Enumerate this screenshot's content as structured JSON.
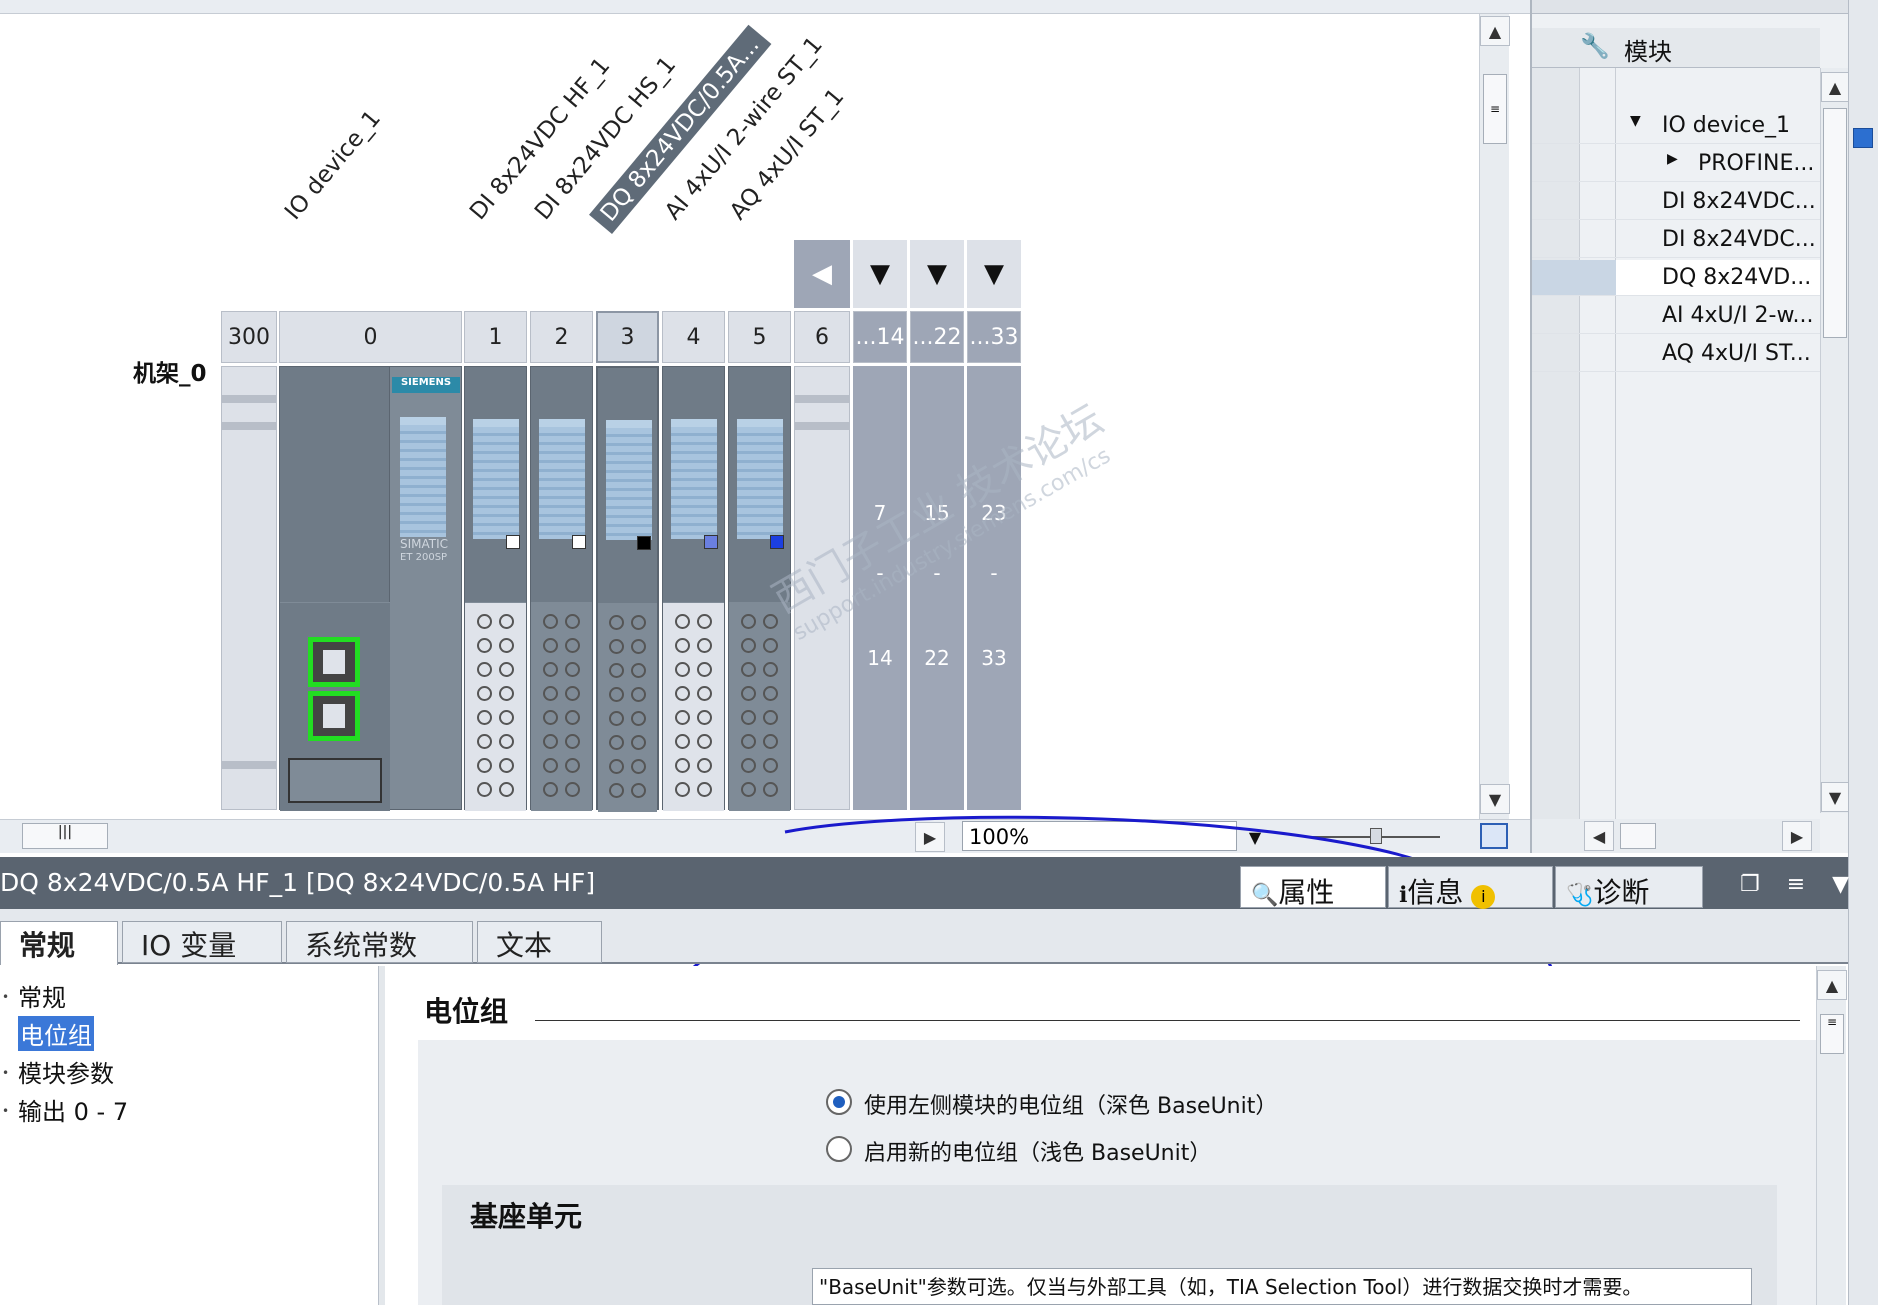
{
  "device_view": {
    "vertical_labels": [
      "IO device_1",
      "DI 8x24VDC HF_1",
      "DI 8x24VDC HS_1",
      "DQ 8x24VDC/0.5A...",
      "AI 4xU/I 2-wire ST_1",
      "AQ 4xU/I ST_1"
    ],
    "rack_label": "机架_0",
    "slot_numbers": [
      "300",
      "0",
      "1",
      "2",
      "3",
      "4",
      "5",
      "6",
      "...14",
      "...22",
      "...33"
    ],
    "empty_slot_ranges": [
      {
        "start": "7",
        "dash": "-",
        "end": "14"
      },
      {
        "start": "15",
        "dash": "-",
        "end": "22"
      },
      {
        "start": "23",
        "dash": "-",
        "end": "33"
      }
    ],
    "siemens_label": "SIEMENS",
    "simatic_label": "SIMATIC",
    "et200sp_label": "ET 200SP",
    "watermark_lines": [
      "西门子工业 技术论坛",
      "support.industry.siemens.com/cs"
    ],
    "zoom_value": "100%"
  },
  "module_panel": {
    "header": "模块",
    "items": [
      {
        "label": "IO device_1",
        "arrow": "▼"
      },
      {
        "label": "PROFINE...",
        "arrow": "▶"
      },
      {
        "label": "DI 8x24VDC...",
        "arrow": ""
      },
      {
        "label": "DI 8x24VDC...",
        "arrow": ""
      },
      {
        "label": "DQ 8x24VD...",
        "arrow": ""
      },
      {
        "label": "AI 4xU/I 2-w...",
        "arrow": ""
      },
      {
        "label": "AQ 4xU/I ST...",
        "arrow": ""
      }
    ]
  },
  "inspector": {
    "title": "DQ 8x24VDC/0.5A HF_1 [DQ 8x24VDC/0.5A HF]",
    "tabs": [
      "属性",
      "信息",
      "诊断"
    ],
    "property_tabs": [
      "常规",
      "IO 变量",
      "系统常数",
      "文本"
    ],
    "nav_items": [
      "常规",
      "电位组",
      "模块参数",
      "输出 0 - 7"
    ],
    "section_title": "电位组",
    "radio_options": [
      {
        "label": "使用左侧模块的电位组（深色 BaseUnit）",
        "checked": true
      },
      {
        "label": "启用新的电位组（浅色 BaseUnit）",
        "checked": false
      }
    ],
    "subsection_title": "基座单元",
    "description": "\"BaseUnit\"参数可选。仅当与外部工具（如，TIA Selection Tool）进行数据交换时才需要。"
  },
  "colors": {
    "module_gray": "#7f8b97",
    "selection_blue": "#3b78d8",
    "annotation_blue": "#1a1acc",
    "port_green": "#22dd22"
  }
}
